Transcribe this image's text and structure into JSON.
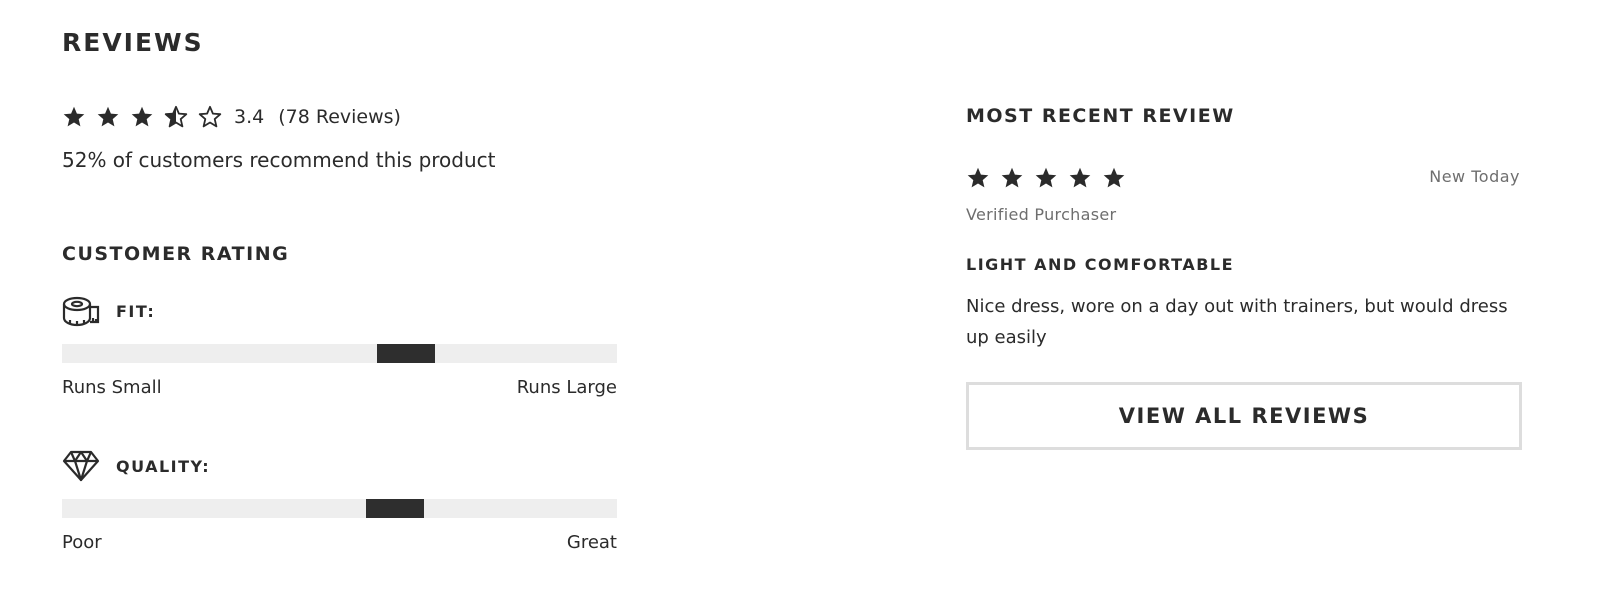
{
  "reviews": {
    "title": "REVIEWS",
    "summary": {
      "stars": [
        "star-full",
        "star-full",
        "star-full",
        "star-half",
        "star-empty"
      ],
      "average": "3.4",
      "count_text": "(78 Reviews)",
      "recommend_text": "52% of customers recommend this product"
    },
    "customer_rating": {
      "title": "CUSTOMER RATING",
      "fit": {
        "icon": "tape-measure-icon",
        "label": "FIT:",
        "min_label": "Runs Small",
        "max_label": "Runs Large",
        "value_percent": 62
      },
      "quality": {
        "icon": "diamond-icon",
        "label": "QUALITY:",
        "min_label": "Poor",
        "max_label": "Great",
        "value_percent": 60
      }
    },
    "most_recent": {
      "title": "MOST RECENT REVIEW",
      "stars": [
        "star-full",
        "star-full",
        "star-full",
        "star-full",
        "star-full"
      ],
      "date": "New Today",
      "verified": "Verified Purchaser",
      "headline": "LIGHT AND COMFORTABLE",
      "body": "Nice dress, wore on a day out with trainers, but would dress up easily"
    },
    "view_all_label": "VIEW ALL REVIEWS"
  },
  "colors": {
    "text": "#2b2b2b",
    "muted": "#6e6e6e",
    "track": "#eeeeee",
    "marker": "#2e2e2e",
    "button_border": "#dddddd"
  }
}
